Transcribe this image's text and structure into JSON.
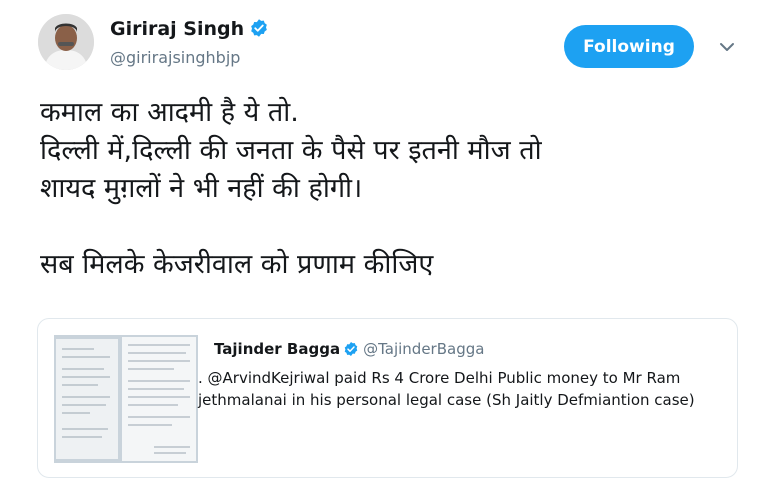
{
  "author": {
    "name": "Giriraj Singh",
    "handle": "@girirajsinghbjp"
  },
  "follow_button": {
    "label": "Following"
  },
  "tweet": {
    "line1": "कमाल का आदमी है ये तो.",
    "line2": "दिल्ली में,दिल्ली की जनता के पैसे पर इतनी मौज तो",
    "line3": "शायद मुग़लों ने भी नहीं की होगी।",
    "line4": "सब मिलके केजरीवाल को प्रणाम कीजिए"
  },
  "quoted": {
    "name": "Tajinder Bagga",
    "handle": "@TajinderBagga",
    "text": ". @ArvindKejriwal paid Rs 4 Crore Delhi Public money to Mr Ram jethmalanai in his personal legal case (Sh Jaitly Defmiantion case)"
  },
  "colors": {
    "accent": "#1da1f2",
    "text": "#14171a",
    "secondary": "#657786",
    "border": "#e1e8ed"
  },
  "icons": {
    "verified": "verified-badge-icon",
    "more": "chevron-down-icon"
  }
}
